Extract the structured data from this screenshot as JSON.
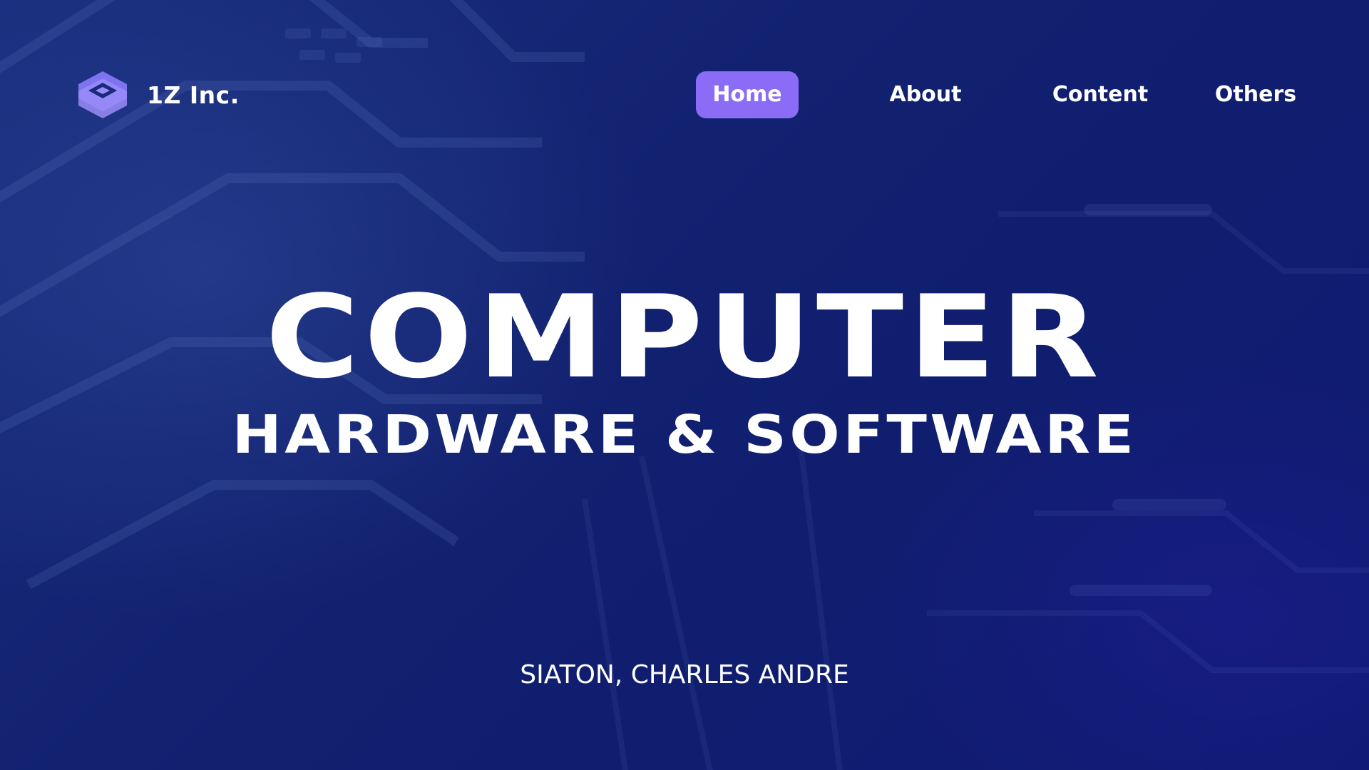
{
  "brand": {
    "name": "1Z Inc.",
    "icon": "layered-hexagon-logo-icon",
    "icon_color": "#8b7cf6"
  },
  "nav": {
    "items": [
      {
        "label": "Home",
        "active": true
      },
      {
        "label": "About",
        "active": false
      },
      {
        "label": "Content",
        "active": false
      },
      {
        "label": "Others",
        "active": false
      }
    ],
    "active_color": "#8b6cf6"
  },
  "hero": {
    "title": "COMPUTER",
    "subtitle": "HARDWARE & SOFTWARE"
  },
  "author": "SIATON, CHARLES ANDRE",
  "colors": {
    "background": "#101e6e",
    "text": "#ffffff"
  }
}
